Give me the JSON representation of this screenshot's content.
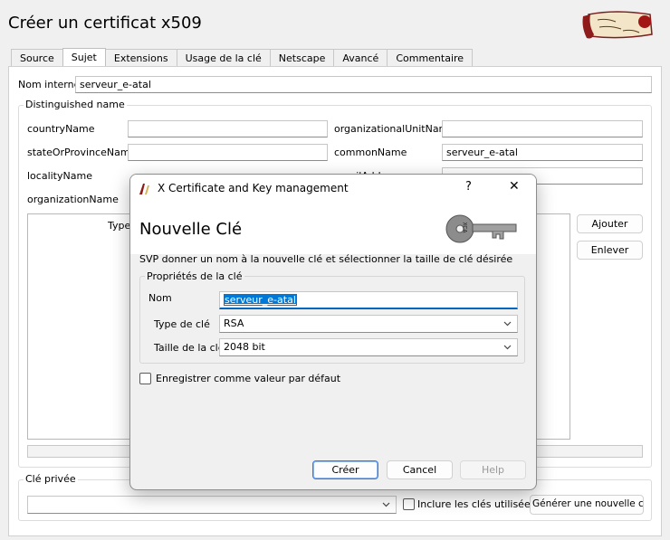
{
  "window": {
    "title": "Créer un certificat x509"
  },
  "tabs": [
    "Source",
    "Sujet",
    "Extensions",
    "Usage de la clé",
    "Netscape",
    "Avancé",
    "Commentaire"
  ],
  "subject": {
    "internal_name_label": "Nom interne",
    "internal_name_value": "serveur_e-atal",
    "dn_group_title": "Distinguished name",
    "left_fields": [
      {
        "label": "countryName",
        "value": ""
      },
      {
        "label": "stateOrProvinceName",
        "value": ""
      },
      {
        "label": "localityName",
        "value": ""
      },
      {
        "label": "organizationName",
        "value": ""
      }
    ],
    "right_fields": [
      {
        "label": "organizationalUnitName",
        "value": ""
      },
      {
        "label": "commonName",
        "value": "serveur_e-atal"
      },
      {
        "label": "emailAddress",
        "value": ""
      }
    ],
    "table_header_type": "Type",
    "add_button": "Ajouter",
    "remove_button": "Enlever"
  },
  "private_key": {
    "group_title": "Clé privée",
    "selected": "",
    "include_used_label": "Inclure les clés utilisées",
    "generate_button": "Générer une nouvelle clé"
  },
  "dialog": {
    "title": "X Certificate and Key management",
    "help_glyph": "?",
    "close_glyph": "✕",
    "heading": "Nouvelle Clé",
    "key_tag": "XCA",
    "description": "SVP donner un nom à la nouvelle clé et sélectionner la taille de clé désirée",
    "group_title": "Propriétés de la clé",
    "name_label": "Nom",
    "name_value": "serveur_e-atal",
    "type_label": "Type de clé",
    "type_value": "RSA",
    "size_label": "Taille de la clé",
    "size_value": "2048 bit",
    "remember_label": "Enregistrer comme valeur par défaut",
    "create_button": "Créer",
    "cancel_button": "Cancel",
    "help_button": "Help"
  },
  "colors": {
    "accent": "#0067c0",
    "selection": "#0078d7"
  }
}
